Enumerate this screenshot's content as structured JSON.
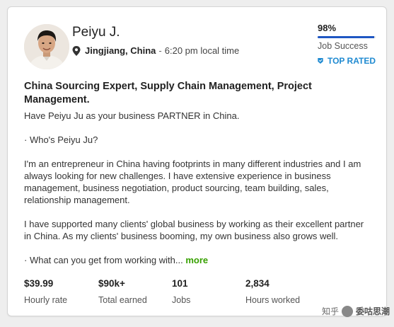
{
  "profile": {
    "name": "Peiyu J.",
    "city": "Jingjiang, China",
    "local_time": "6:20 pm local time",
    "separator": "-"
  },
  "job_success": {
    "value": "98%",
    "percent": 98,
    "label": "Job Success",
    "badge": "TOP RATED",
    "bar_color": "#1f57c3",
    "badge_color": "#1f8ad1"
  },
  "title": "China Sourcing Expert, Supply Chain Management, Project Management.",
  "description": {
    "p1": "Have Peiyu Ju as your business PARTNER in China.",
    "p2": "· Who's Peiyu Ju?",
    "p3": "I'm an entrepreneur in China having footprints in many different industries and I am always looking for new challenges. I have extensive experience in business management, business negotiation, product sourcing, team building, sales, relationship management.",
    "p4": "I have supported many clients' global business by working as their excellent partner in China. As my clients' business booming, my own business also grows well.",
    "p5": "· What can you get from working with...",
    "more": "more",
    "more_color": "#37a000"
  },
  "stats": [
    {
      "value": "$39.99",
      "label": "Hourly rate"
    },
    {
      "value": "$90k+",
      "label": "Total earned"
    },
    {
      "value": "101",
      "label": "Jobs"
    },
    {
      "value": "2,834",
      "label": "Hours worked"
    }
  ],
  "watermark": {
    "prefix": "知乎",
    "brand": "委咕思潮"
  },
  "icons": {
    "location": "location-pin-icon",
    "badge": "top-rated-badge-icon",
    "watermark": "zhihu-logo-icon"
  }
}
